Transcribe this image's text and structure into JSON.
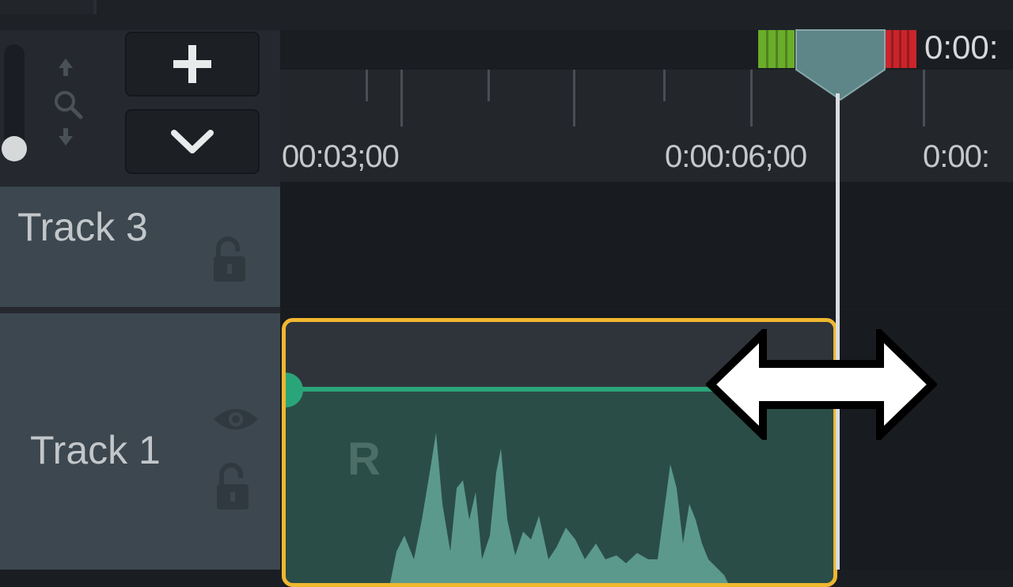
{
  "ruler": {
    "labels": [
      "00:03;00",
      "0:00:06;00",
      "0:00:"
    ]
  },
  "playhead": {
    "time_label": "0:00:"
  },
  "toolbar": {
    "add_track_icon": "plus-icon",
    "collapse_icon": "chevron-down-icon",
    "zoom_icons": [
      "arrow-up-icon",
      "magnifier-icon",
      "arrow-down-icon"
    ]
  },
  "tracks": [
    {
      "label": "Track 3",
      "visible": true,
      "locked": false
    },
    {
      "label": "Track 1",
      "visible": true,
      "locked": false
    }
  ],
  "clip": {
    "channel_letter": "R",
    "type": "audio"
  },
  "colors": {
    "clip_border": "#f0b72f",
    "clip_fill": "#2b4d47",
    "volume_line": "#2aa57a",
    "in_marker": "#6aad2a",
    "out_marker": "#c9252b"
  }
}
